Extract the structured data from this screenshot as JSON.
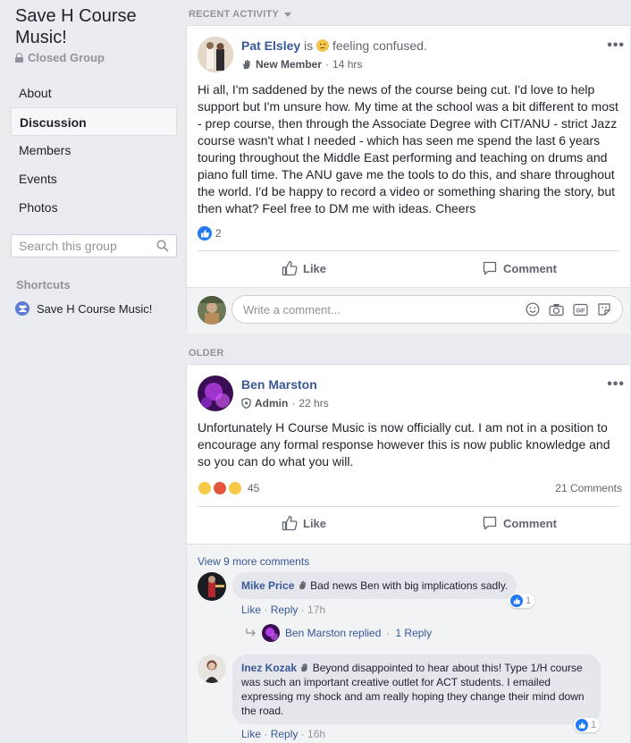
{
  "group": {
    "title": "Save H Course Music!",
    "privacy": "Closed Group"
  },
  "nav": {
    "items": [
      "About",
      "Discussion",
      "Members",
      "Events",
      "Photos"
    ],
    "active": "Discussion"
  },
  "search": {
    "placeholder": "Search this group"
  },
  "shortcuts": {
    "heading": "Shortcuts",
    "item": "Save H Course Music!"
  },
  "sections": {
    "recent": "RECENT ACTIVITY",
    "older": "OLDER"
  },
  "post1": {
    "author": "Pat Elsley",
    "feeling_prefix": "is",
    "feeling": "feeling confused.",
    "badge": "New Member",
    "time": "14 hrs",
    "body": "Hi all, I'm saddened by the news of the course being cut. I'd love to help support but I'm unsure how. My time at the school was a bit different to most - prep course, then through the Associate Degree with CIT/ANU - strict Jazz course wasn't what I needed - which has seen me spend the last 6 years touring throughout the Middle East performing and teaching on drums and piano full time. The ANU gave me the tools to do this, and share throughout the world. I'd be happy to record a video or something sharing the story, but then what? Feel free to DM me with ideas. Cheers",
    "like_count": "2",
    "like_label": "Like",
    "comment_label": "Comment",
    "comment_placeholder": "Write a comment..."
  },
  "post2": {
    "author": "Ben Marston",
    "badge": "Admin",
    "time": "22 hrs",
    "body": "Unfortunately H Course Music is now officially cut. I am not in a position to encourage any formal response however this is now public knowledge and so you can do what you will.",
    "reaction_count": "45",
    "comments_count": "21 Comments",
    "like_label": "Like",
    "comment_label": "Comment",
    "view_more": "View 9 more comments",
    "comments": [
      {
        "name": "Mike Price",
        "text": "Bad news Ben with big implications sadly.",
        "like": "Like",
        "reply": "Reply",
        "time": "17h",
        "react_count": "1"
      },
      {
        "name": "Inez Kozak",
        "text": "Beyond disappointed to hear about this! Type 1/H course was such an important creative outlet for ACT students. I emailed expressing my shock and am really hoping they change their mind down the road.",
        "like": "Like",
        "reply": "Reply",
        "time": "16h",
        "react_count": "1"
      }
    ],
    "reply_thread": {
      "who": "Ben Marston replied",
      "count": "1 Reply"
    }
  },
  "colors": {
    "link": "#385898",
    "like_blue": "#2078f4",
    "bg": "#e9ebee"
  }
}
